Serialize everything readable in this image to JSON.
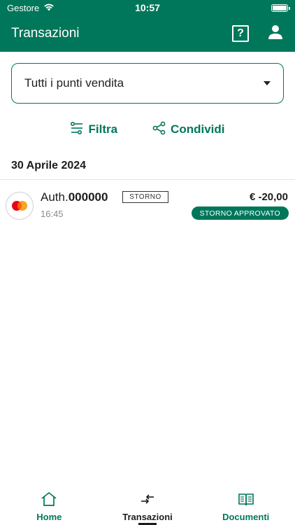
{
  "status_bar": {
    "carrier": "Gestore",
    "time": "10:57"
  },
  "header": {
    "title": "Transazioni"
  },
  "store_select": {
    "value": "Tutti i punti vendita"
  },
  "actions": {
    "filter_label": "Filtra",
    "share_label": "Condividi"
  },
  "groups": [
    {
      "date": "30 Aprile 2024",
      "transactions": [
        {
          "auth_prefix": "Auth.",
          "auth_code": "000000",
          "type": "STORNO",
          "time": "16:45",
          "amount": "€ -20,00",
          "status": "STORNO APPROVATO",
          "card_icon": "mastercard-icon"
        }
      ]
    }
  ],
  "tabbar": {
    "items": [
      {
        "label": "Home",
        "icon": "home-icon"
      },
      {
        "label": "Transazioni",
        "icon": "transfer-arrows-icon",
        "active": true
      },
      {
        "label": "Documenti",
        "icon": "book-icon"
      }
    ]
  },
  "colors": {
    "brand": "#00775a",
    "mastercard_red": "#eb001b",
    "mastercard_yellow": "#f79e1b"
  }
}
